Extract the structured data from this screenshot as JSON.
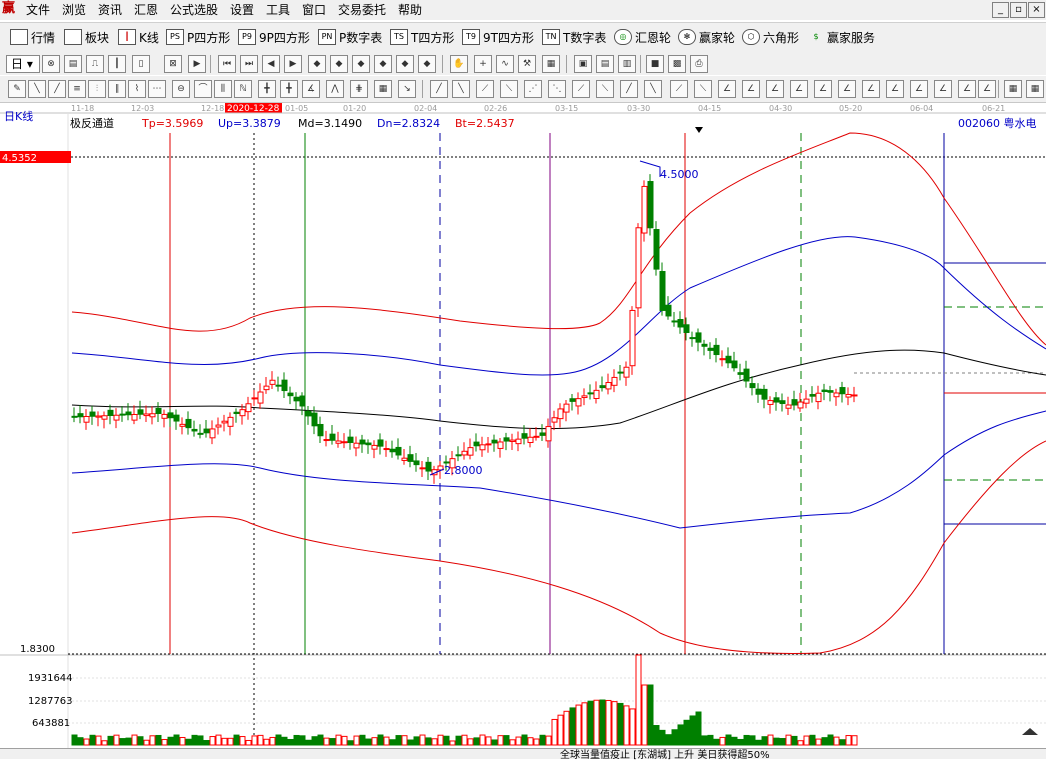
{
  "menu": {
    "logo": "赢",
    "items": [
      "文件",
      "浏览",
      "资讯",
      "汇恩",
      "公式选股",
      "设置",
      "工具",
      "窗口",
      "交易委托",
      "帮助"
    ]
  },
  "toolbar": {
    "dropdown_value": "日",
    "items": [
      {
        "icon": "table-icon",
        "label": "行情"
      },
      {
        "icon": "blocks-icon",
        "label": "板块"
      },
      {
        "icon": "kline-icon",
        "label": "K线"
      },
      {
        "icon": "ps-icon",
        "icon_text": "PS",
        "label": "P四方形"
      },
      {
        "icon": "p9-icon",
        "icon_text": "P9",
        "label": "9P四方形"
      },
      {
        "icon": "pn-icon",
        "icon_text": "PN",
        "label": "P数字表"
      },
      {
        "icon": "ts-icon",
        "icon_text": "TS",
        "label": "T四方形"
      },
      {
        "icon": "t9-icon",
        "icon_text": "T9",
        "label": "9T四方形"
      },
      {
        "icon": "tn-icon",
        "icon_text": "TN",
        "label": "T数字表"
      },
      {
        "icon": "target-icon",
        "label": "汇恩轮"
      },
      {
        "icon": "wheel-icon",
        "label": "赢家轮"
      },
      {
        "icon": "hexagon-icon",
        "label": "六角形"
      },
      {
        "icon": "dollar-icon",
        "label": "赢家服务"
      }
    ]
  },
  "chart": {
    "period_label": "日K线",
    "indicator_name": "极反通道",
    "tp": "Tp=3.5969",
    "up": "Up=3.3879",
    "md": "Md=3.1490",
    "dn": "Dn=2.8324",
    "bt": "Bt=2.5437",
    "stock": "002060  粤水电",
    "price_flag": "4.5352",
    "price_low": "1.8300",
    "high_label": "4.5000",
    "low_label": "2.8000",
    "highlight_date": "2020-12-28",
    "dates": [
      "11-18",
      "12-03",
      "12-18",
      "01-05",
      "01-20",
      "02-04",
      "02-26",
      "03-15",
      "03-30",
      "04-15",
      "04-30",
      "05-20",
      "06-04",
      "06-21"
    ],
    "volume_ticks": [
      "1931644",
      "1287763",
      "643881"
    ],
    "colors": {
      "up": "#ff0000",
      "down": "#008000",
      "mid": "#000000",
      "band_blue": "#0000c8",
      "band_red": "#e00000",
      "highlight": "#ff0000"
    }
  },
  "status": {
    "news": "全球当量值疫止 [东湖城] 上升 美日获得超50%"
  }
}
